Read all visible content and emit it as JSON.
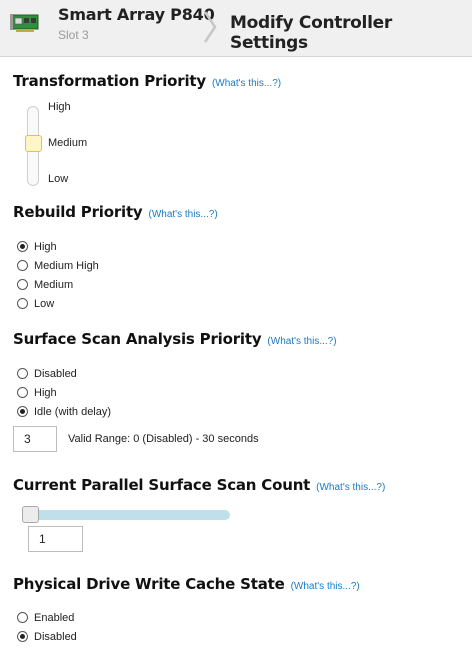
{
  "header": {
    "controller_name": "Smart Array P840",
    "slot": "Slot 3",
    "page_title": "Modify Controller Settings",
    "icon": "controller-card-icon"
  },
  "help_label": "(What's this...?)",
  "transformation": {
    "title": "Transformation Priority",
    "levels": [
      "High",
      "Medium",
      "Low"
    ],
    "selected": "Medium"
  },
  "rebuild": {
    "title": "Rebuild Priority",
    "options": [
      "High",
      "Medium High",
      "Medium",
      "Low"
    ],
    "selected": "High"
  },
  "surface_scan": {
    "title": "Surface Scan Analysis Priority",
    "options": [
      "Disabled",
      "High",
      "Idle (with delay)"
    ],
    "selected": "Idle (with delay)",
    "delay_value": "3",
    "valid_range": "Valid Range: 0 (Disabled) - 30 seconds"
  },
  "parallel_scan": {
    "title": "Current Parallel Surface Scan Count",
    "value": "1",
    "slider_fraction": 0
  },
  "write_cache": {
    "title": "Physical Drive Write Cache State",
    "options": [
      "Enabled",
      "Disabled"
    ],
    "selected": "Disabled"
  },
  "colors": {
    "accent_link": "#1a7ac4",
    "slider_thumb_active": "#fff6c8",
    "slider_track": "#bfe0ea",
    "header_bg": "#f0f0f0"
  }
}
